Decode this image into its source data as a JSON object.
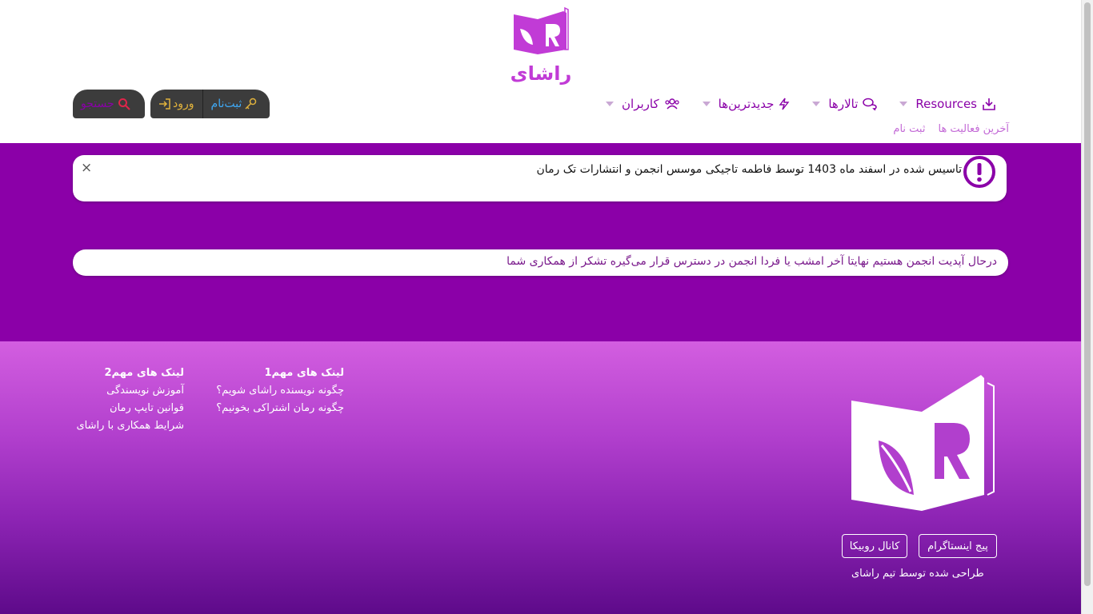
{
  "header": {
    "logo_text": "راشای",
    "nav": [
      {
        "label": "Resources",
        "icon": "download-box-icon"
      },
      {
        "label": "تالارها",
        "icon": "comments-icon"
      },
      {
        "label": "جدیدترین‌ها",
        "icon": "bolt-icon"
      },
      {
        "label": "کاربران",
        "icon": "users-icon"
      }
    ],
    "subnav": [
      "آخرین فعالیت ها",
      "ثبت نام"
    ],
    "search_label": "جستجو",
    "login_label": "ورود",
    "register_label": "ثبت‌نام"
  },
  "notice": {
    "text": "تاسیس شده در اسفند ماه 1403 توسط فاطمه تاجیکی موسس انجمن و انتشارات تک رمان",
    "close": "×",
    "icon": "exclamation-circle-icon"
  },
  "update_bar": {
    "text": "درحال آپدیت انجمن هستیم نهایتا آخر امشب یا فردا انجمن در دسترس قرار می‌گیره تشکر از همکاری شما"
  },
  "footer": {
    "col1": {
      "heading": "لینک های مهم1",
      "links": [
        "چگونه نویسنده راشای شویم؟",
        "چگونه رمان اشتراکی بخونیم؟"
      ]
    },
    "col2": {
      "heading": "لینک های مهم2",
      "links": [
        "آموزش نویسندگی",
        "قوانین تایپ رمان",
        "شرایط همکاری با راشای"
      ]
    },
    "instagram": "پیج اینستاگرام",
    "rubika": "کانال روبیکا",
    "credit": "طراحی شده توسط تیم راشای"
  },
  "colors": {
    "brand": "#8b00a8",
    "nav_text": "#8a00a8",
    "footer_top": "#d35ee0",
    "footer_bottom": "#5e0a8a"
  }
}
